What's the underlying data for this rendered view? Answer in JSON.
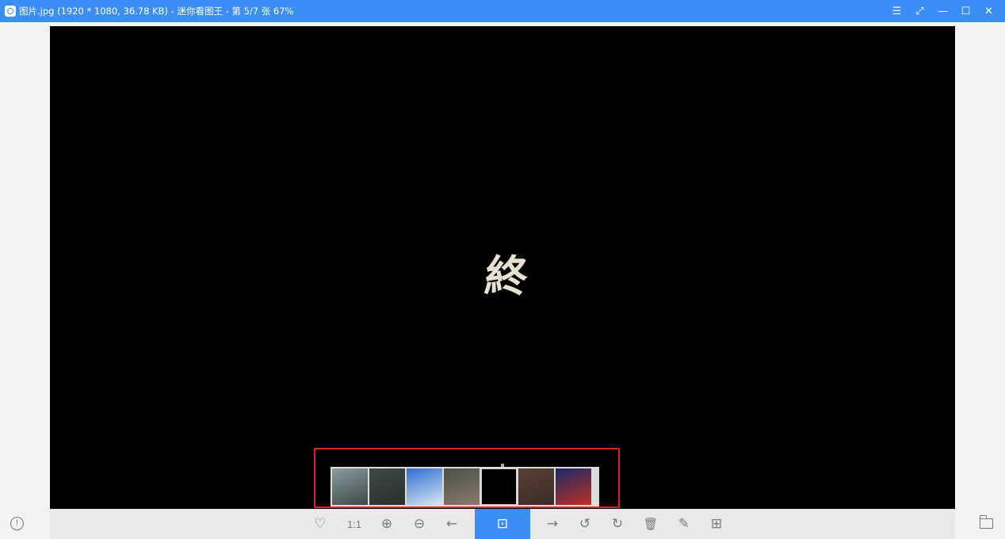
{
  "window": {
    "title": "图片.jpg (1920 * 1080, 36.78 KB) - 迷你看图王 - 第 5/7 张 67%",
    "controls": [
      "menu-icon",
      "fullscreen-icon",
      "minimize-icon",
      "maximize-icon",
      "close-icon"
    ],
    "control_glyphs": {
      "menu": "☰",
      "fullscreen": "⤢",
      "minimize": "—",
      "maximize": "☐",
      "close": "✕"
    }
  },
  "image": {
    "glyph": "終"
  },
  "thumbnails": [
    {
      "name": "thumb-1",
      "colors": [
        "#8a9aa0",
        "#3c4a48"
      ]
    },
    {
      "name": "thumb-2",
      "colors": [
        "#3e4a48",
        "#26302e"
      ]
    },
    {
      "name": "thumb-3",
      "colors": [
        "#2e6fd0",
        "#d9e6f3"
      ]
    },
    {
      "name": "thumb-4",
      "colors": [
        "#4a5048",
        "#8a7a6a"
      ]
    },
    {
      "name": "thumb-5",
      "colors": [
        "#000000",
        "#000000"
      ],
      "current": true
    },
    {
      "name": "thumb-6",
      "colors": [
        "#5a4034",
        "#3a2c28"
      ]
    },
    {
      "name": "thumb-7",
      "colors": [
        "#1a2a6a",
        "#c03020"
      ]
    }
  ],
  "toolbar": {
    "favorite_glyph": "♡",
    "actual_size_label": "1:1",
    "zoom_in_glyph": "⊕",
    "zoom_out_glyph": "⊖",
    "prev_glyph": "←",
    "slideshow_glyph": "⊡",
    "next_glyph": "→",
    "rotate_left_glyph": "↺",
    "rotate_right_glyph": "↻",
    "delete_glyph": "🗑",
    "edit_glyph": "✎",
    "grid_glyph": "⊞"
  },
  "footer": {
    "info_glyph": "!"
  },
  "colors": {
    "accent": "#3a8ef6",
    "highlight": "#e0251b"
  }
}
